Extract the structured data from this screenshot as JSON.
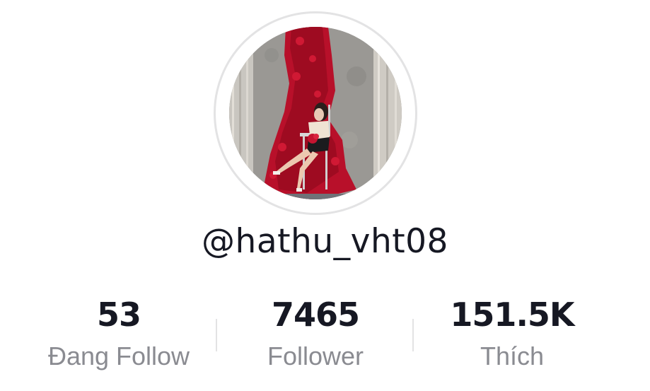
{
  "profile": {
    "username": "@hathu_vht08",
    "avatar_alt": "profile photo"
  },
  "stats": [
    {
      "value": "53",
      "label": "Đang Follow"
    },
    {
      "value": "7465",
      "label": "Follower"
    },
    {
      "value": "151.5K",
      "label": "Thích"
    }
  ],
  "colors": {
    "text_primary": "#161823",
    "text_secondary": "#8a8b91",
    "divider": "#e3e3e4",
    "rose_red": "#b8102a"
  }
}
